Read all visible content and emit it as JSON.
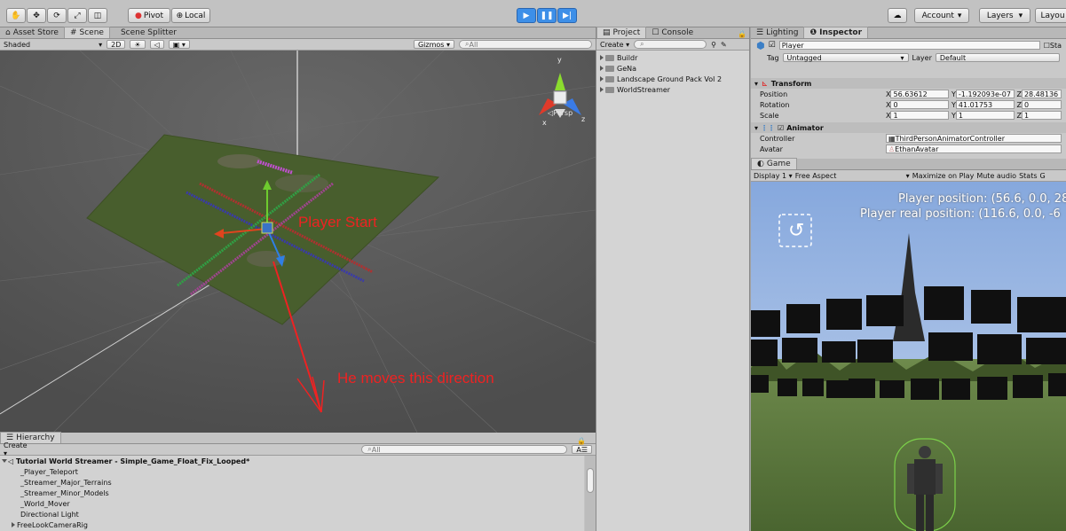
{
  "toolbar": {
    "pivot_label": "Pivot",
    "local_label": "Local",
    "account_label": "Account",
    "layers_label": "Layers",
    "layout_label": "Layou"
  },
  "scene_tabs": [
    "Asset Store",
    "Scene",
    "Scene Splitter"
  ],
  "scene_toolbar": {
    "shading": "Shaded",
    "mode_2d": "2D",
    "gizmos": "Gizmos",
    "search_placeholder": "All",
    "persp": "Persp"
  },
  "annotations": {
    "player_start": "Player Start",
    "direction": "He moves this direction"
  },
  "hierarchy": {
    "tab": "Hierarchy",
    "create": "Create",
    "search_placeholder": "All",
    "scene_name": "Tutorial World Streamer - Simple_Game_Float_Fix_Looped*",
    "items": [
      "_Player_Teleport",
      "_Streamer_Major_Terrains",
      "_Streamer_Minor_Models",
      "_World_Mover",
      "Directional Light",
      "FreeLookCameraRig"
    ]
  },
  "project": {
    "tabs": [
      "Project",
      "Console"
    ],
    "create": "Create",
    "folders": [
      "Buildr",
      "GeNa",
      "Landscape Ground Pack  Vol 2",
      "WorldStreamer"
    ]
  },
  "inspector": {
    "tabs": [
      "Lighting",
      "Inspector"
    ],
    "object_name": "Player",
    "static_label": "Sta",
    "tag_label": "Tag",
    "tag_value": "Untagged",
    "layer_label": "Layer",
    "layer_value": "Default",
    "transform": {
      "title": "Transform",
      "rows": [
        {
          "label": "Position",
          "x": "56.63612",
          "y": "-1.192093e-07",
          "z": "28.48136"
        },
        {
          "label": "Rotation",
          "x": "0",
          "y": "41.01753",
          "z": "0"
        },
        {
          "label": "Scale",
          "x": "1",
          "y": "1",
          "z": "1"
        }
      ]
    },
    "animator": {
      "title": "Animator",
      "controller_label": "Controller",
      "controller_value": "ThirdPersonAnimatorController",
      "avatar_label": "Avatar",
      "avatar_value": "EthanAvatar"
    }
  },
  "game": {
    "tab": "Game",
    "display": "Display 1",
    "aspect": "Free Aspect",
    "buttons": [
      "Maximize on Play",
      "Mute audio",
      "Stats",
      "G"
    ],
    "line1": "Player position: (56.6, 0.0, 28",
    "line2": "Player real position: (116.6, 0.0, -6"
  },
  "colors": {
    "play_accent": "#3d8fe8",
    "annotation": "#ee2222",
    "sky": "#86a8dd",
    "ground": "#55703a"
  }
}
